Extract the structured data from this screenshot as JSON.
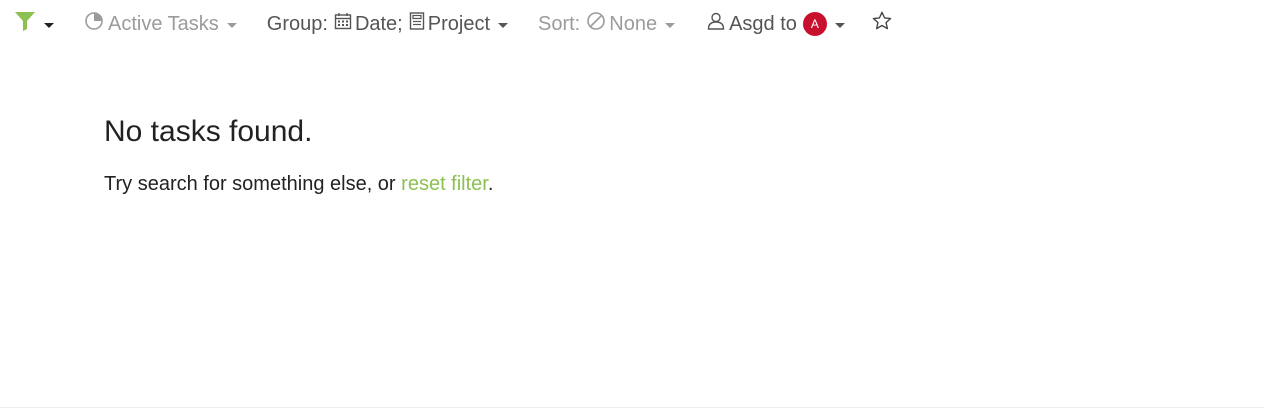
{
  "toolbar": {
    "filter_icon": "filter-funnel-icon",
    "filter_color": "#8cc152",
    "preset": {
      "icon": "pie-chart-icon",
      "label": "Active Tasks"
    },
    "group": {
      "prefix": "Group:",
      "items": [
        {
          "icon": "calendar-icon",
          "label": "Date;"
        },
        {
          "icon": "project-doc-icon",
          "label": "Project"
        }
      ]
    },
    "sort": {
      "prefix": "Sort:",
      "icon": "ban-circle-icon",
      "label": "None"
    },
    "assigned": {
      "icon": "user-icon",
      "label": "Asgd to",
      "avatar_initial": "A",
      "avatar_color": "#c8102e"
    },
    "favorite_icon": "star-outline-icon"
  },
  "empty_state": {
    "title": "No tasks found.",
    "message_before": "Try search for something else, or ",
    "link_label": "reset filter",
    "message_after": "."
  }
}
